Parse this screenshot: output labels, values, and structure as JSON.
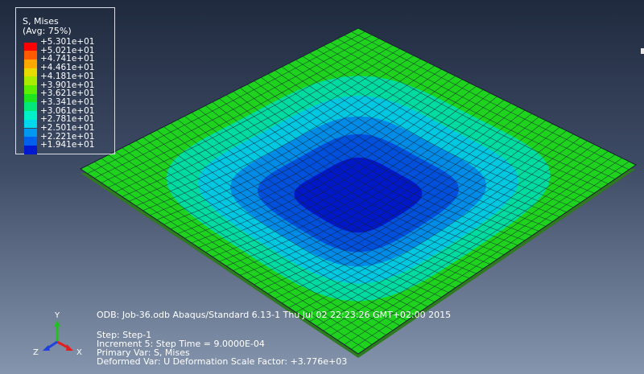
{
  "legend": {
    "title": "S, Mises",
    "subtitle": "(Avg: 75%)",
    "entries": [
      {
        "label": "+5.301e+01",
        "color": "#ff0000"
      },
      {
        "label": "+5.021e+01",
        "color": "#ff5a00"
      },
      {
        "label": "+4.741e+01",
        "color": "#ffa800"
      },
      {
        "label": "+4.461e+01",
        "color": "#e6dc00"
      },
      {
        "label": "+4.181e+01",
        "color": "#a8ec00"
      },
      {
        "label": "+3.901e+01",
        "color": "#5cf000"
      },
      {
        "label": "+3.621e+01",
        "color": "#1ee61e"
      },
      {
        "label": "+3.341e+01",
        "color": "#00e87a"
      },
      {
        "label": "+3.061e+01",
        "color": "#00f0c8"
      },
      {
        "label": "+2.781e+01",
        "color": "#00d8ee"
      },
      {
        "label": "+2.501e+01",
        "color": "#0098f0"
      },
      {
        "label": "+2.221e+01",
        "color": "#0060ee"
      },
      {
        "label": "+1.941e+01",
        "color": "#0018d0"
      }
    ]
  },
  "info": {
    "odb_line": "ODB: Job-36.odb    Abaqus/Standard 6.13-1    Thu Jul 02 22:23:26 GMT+02:00 2015",
    "step_line": "Step: Step-1",
    "increment_line": "Increment      5: Step Time =    9.0000E-04",
    "primary_var_line": "Primary Var: S, Mises",
    "deformed_var_line": "Deformed Var: U   Deformation Scale Factor: +3.776e+03"
  },
  "triad": {
    "x_label": "X",
    "y_label": "Y",
    "z_label": "Z",
    "x_color": "#e02020",
    "y_color": "#20c020",
    "z_color": "#2040e0"
  },
  "plate_colors": {
    "zone1": "#1ed21e",
    "zone2": "#00dca0",
    "zone3": "#00c8e0",
    "zone4": "#008ce6",
    "zone5": "#0050dc",
    "zone6": "#0018c8",
    "mesh": "#1a2233",
    "underside": "#2e7a1e"
  }
}
